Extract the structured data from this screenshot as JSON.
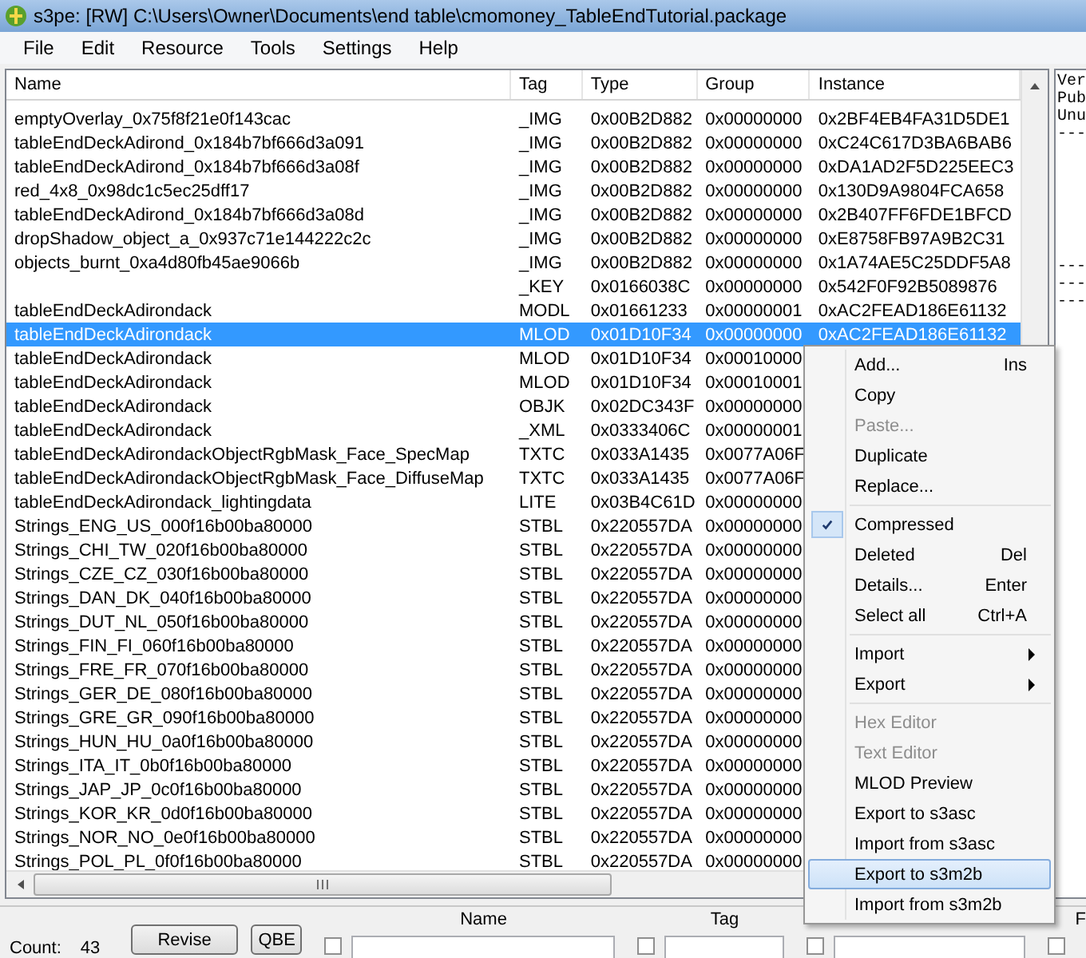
{
  "window": {
    "title": "s3pe: [RW] C:\\Users\\Owner\\Documents\\end table\\cmomoney_TableEndTutorial.package"
  },
  "menu": [
    "File",
    "Edit",
    "Resource",
    "Tools",
    "Settings",
    "Help"
  ],
  "table": {
    "columns": [
      "Name",
      "Tag",
      "Type",
      "Group",
      "Instance"
    ],
    "rows": [
      {
        "name": "emptyOverlay_0x75f8f21e0f143cac",
        "tag": "_IMG",
        "type": "0x00B2D882",
        "group": "0x00000000",
        "instance": "0x2BF4EB4FA31D5DE1",
        "selected": false
      },
      {
        "name": "tableEndDeckAdirond_0x184b7bf666d3a091",
        "tag": "_IMG",
        "type": "0x00B2D882",
        "group": "0x00000000",
        "instance": "0xC24C617D3BA6BAB6",
        "selected": false
      },
      {
        "name": "tableEndDeckAdirond_0x184b7bf666d3a08f",
        "tag": "_IMG",
        "type": "0x00B2D882",
        "group": "0x00000000",
        "instance": "0xDA1AD2F5D225EEC3",
        "selected": false
      },
      {
        "name": "red_4x8_0x98dc1c5ec25dff17",
        "tag": "_IMG",
        "type": "0x00B2D882",
        "group": "0x00000000",
        "instance": "0x130D9A9804FCA658",
        "selected": false
      },
      {
        "name": "tableEndDeckAdirond_0x184b7bf666d3a08d",
        "tag": "_IMG",
        "type": "0x00B2D882",
        "group": "0x00000000",
        "instance": "0x2B407FF6FDE1BFCD",
        "selected": false
      },
      {
        "name": "dropShadow_object_a_0x937c71e144222c2c",
        "tag": "_IMG",
        "type": "0x00B2D882",
        "group": "0x00000000",
        "instance": "0xE8758FB97A9B2C31",
        "selected": false
      },
      {
        "name": "objects_burnt_0xa4d80fb45ae9066b",
        "tag": "_IMG",
        "type": "0x00B2D882",
        "group": "0x00000000",
        "instance": "0x1A74AE5C25DDF5A8",
        "selected": false
      },
      {
        "tag": "_KEY",
        "type": "0x0166038C",
        "group": "0x00000000",
        "instance": "0x542F0F92B5089876",
        "selected": false
      },
      {
        "name": "tableEndDeckAdirondack",
        "tag": "MODL",
        "type": "0x01661233",
        "group": "0x00000001",
        "instance": "0xAC2FEAD186E61132",
        "selected": false
      },
      {
        "name": "tableEndDeckAdirondack",
        "tag": "MLOD",
        "type": "0x01D10F34",
        "group": "0x00000000",
        "instance": "0xAC2FEAD186E61132",
        "selected": true
      },
      {
        "name": "tableEndDeckAdirondack",
        "tag": "MLOD",
        "type": "0x01D10F34",
        "group": "0x00010000",
        "selected": false
      },
      {
        "name": "tableEndDeckAdirondack",
        "tag": "MLOD",
        "type": "0x01D10F34",
        "group": "0x00010001",
        "selected": false
      },
      {
        "name": "tableEndDeckAdirondack",
        "tag": "OBJK",
        "type": "0x02DC343F",
        "group": "0x00000000",
        "selected": false
      },
      {
        "name": "tableEndDeckAdirondack",
        "tag": "_XML",
        "type": "0x0333406C",
        "group": "0x00000001",
        "selected": false
      },
      {
        "name": "tableEndDeckAdirondackObjectRgbMask_Face_SpecMap",
        "tag": "TXTC",
        "type": "0x033A1435",
        "group": "0x0077A06F",
        "selected": false
      },
      {
        "name": "tableEndDeckAdirondackObjectRgbMask_Face_DiffuseMap",
        "tag": "TXTC",
        "type": "0x033A1435",
        "group": "0x0077A06F",
        "selected": false
      },
      {
        "name": "tableEndDeckAdirondack_lightingdata",
        "tag": "LITE",
        "type": "0x03B4C61D",
        "group": "0x00000000",
        "selected": false
      },
      {
        "name": "Strings_ENG_US_000f16b00ba80000",
        "tag": "STBL",
        "type": "0x220557DA",
        "group": "0x00000000",
        "selected": false
      },
      {
        "name": "Strings_CHI_TW_020f16b00ba80000",
        "tag": "STBL",
        "type": "0x220557DA",
        "group": "0x00000000",
        "selected": false
      },
      {
        "name": "Strings_CZE_CZ_030f16b00ba80000",
        "tag": "STBL",
        "type": "0x220557DA",
        "group": "0x00000000",
        "selected": false
      },
      {
        "name": "Strings_DAN_DK_040f16b00ba80000",
        "tag": "STBL",
        "type": "0x220557DA",
        "group": "0x00000000",
        "selected": false
      },
      {
        "name": "Strings_DUT_NL_050f16b00ba80000",
        "tag": "STBL",
        "type": "0x220557DA",
        "group": "0x00000000",
        "selected": false
      },
      {
        "name": "Strings_FIN_FI_060f16b00ba80000",
        "tag": "STBL",
        "type": "0x220557DA",
        "group": "0x00000000",
        "selected": false
      },
      {
        "name": "Strings_FRE_FR_070f16b00ba80000",
        "tag": "STBL",
        "type": "0x220557DA",
        "group": "0x00000000",
        "selected": false
      },
      {
        "name": "Strings_GER_DE_080f16b00ba80000",
        "tag": "STBL",
        "type": "0x220557DA",
        "group": "0x00000000",
        "selected": false
      },
      {
        "name": "Strings_GRE_GR_090f16b00ba80000",
        "tag": "STBL",
        "type": "0x220557DA",
        "group": "0x00000000",
        "selected": false
      },
      {
        "name": "Strings_HUN_HU_0a0f16b00ba80000",
        "tag": "STBL",
        "type": "0x220557DA",
        "group": "0x00000000",
        "selected": false
      },
      {
        "name": "Strings_ITA_IT_0b0f16b00ba80000",
        "tag": "STBL",
        "type": "0x220557DA",
        "group": "0x00000000",
        "selected": false
      },
      {
        "name": "Strings_JAP_JP_0c0f16b00ba80000",
        "tag": "STBL",
        "type": "0x220557DA",
        "group": "0x00000000",
        "selected": false
      },
      {
        "name": "Strings_KOR_KR_0d0f16b00ba80000",
        "tag": "STBL",
        "type": "0x220557DA",
        "group": "0x00000000",
        "selected": false
      },
      {
        "name": "Strings_NOR_NO_0e0f16b00ba80000",
        "tag": "STBL",
        "type": "0x220557DA",
        "group": "0x00000000",
        "selected": false
      },
      {
        "name": "Strings_POL_PL_0f0f16b00ba80000",
        "tag": "STBL",
        "type": "0x220557DA",
        "group": "0x00000000",
        "selected": false
      }
    ]
  },
  "info_panel": {
    "lines": [
      "Ver",
      "Pub",
      "Unu",
      "---",
      "---",
      "---",
      "---"
    ]
  },
  "context_menu": [
    {
      "kind": "item",
      "label": "Add...",
      "shortcut": "Ins",
      "checked": false,
      "disabled": false,
      "selected": false,
      "submenu": false
    },
    {
      "kind": "item",
      "label": "Copy",
      "checked": false,
      "disabled": false,
      "selected": false,
      "submenu": false
    },
    {
      "kind": "item",
      "label": "Paste...",
      "checked": false,
      "disabled": true,
      "selected": false,
      "submenu": false
    },
    {
      "kind": "item",
      "label": "Duplicate",
      "checked": false,
      "disabled": false,
      "selected": false,
      "submenu": false
    },
    {
      "kind": "item",
      "label": "Replace...",
      "checked": false,
      "disabled": false,
      "selected": false,
      "submenu": false
    },
    {
      "kind": "separator"
    },
    {
      "kind": "item",
      "label": "Compressed",
      "checked": true,
      "disabled": false,
      "selected": false,
      "submenu": false
    },
    {
      "kind": "item",
      "label": "Deleted",
      "shortcut": "Del",
      "checked": false,
      "disabled": false,
      "selected": false,
      "submenu": false
    },
    {
      "kind": "item",
      "label": "Details...",
      "shortcut": "Enter",
      "checked": false,
      "disabled": false,
      "selected": false,
      "submenu": false
    },
    {
      "kind": "item",
      "label": "Select all",
      "shortcut": "Ctrl+A",
      "checked": false,
      "disabled": false,
      "selected": false,
      "submenu": false
    },
    {
      "kind": "separator"
    },
    {
      "kind": "item",
      "label": "Import",
      "checked": false,
      "disabled": false,
      "selected": false,
      "submenu": true
    },
    {
      "kind": "item",
      "label": "Export",
      "checked": false,
      "disabled": false,
      "selected": false,
      "submenu": true
    },
    {
      "kind": "separator"
    },
    {
      "kind": "item",
      "label": "Hex Editor",
      "checked": false,
      "disabled": true,
      "selected": false,
      "submenu": false
    },
    {
      "kind": "item",
      "label": "Text Editor",
      "checked": false,
      "disabled": true,
      "selected": false,
      "submenu": false
    },
    {
      "kind": "item",
      "label": "MLOD Preview",
      "checked": false,
      "disabled": false,
      "selected": false,
      "submenu": false
    },
    {
      "kind": "item",
      "label": "Export to s3asc",
      "checked": false,
      "disabled": false,
      "selected": false,
      "submenu": false
    },
    {
      "kind": "item",
      "label": "Import from s3asc",
      "checked": false,
      "disabled": false,
      "selected": false,
      "submenu": false
    },
    {
      "kind": "item",
      "label": "Export to s3m2b",
      "checked": false,
      "disabled": false,
      "selected": true,
      "submenu": false
    },
    {
      "kind": "item",
      "label": "Import from s3m2b",
      "checked": false,
      "disabled": false,
      "selected": false,
      "submenu": false
    }
  ],
  "bottom_panel": {
    "count_label": "Count:",
    "count": "43",
    "buttons": [
      "Revise",
      "QBE"
    ],
    "filters": [
      {
        "label": "Name",
        "checked": false
      },
      {
        "label": "Tag",
        "checked": false
      },
      {
        "checked": false
      },
      {
        "label": "F",
        "checked": false
      }
    ]
  }
}
